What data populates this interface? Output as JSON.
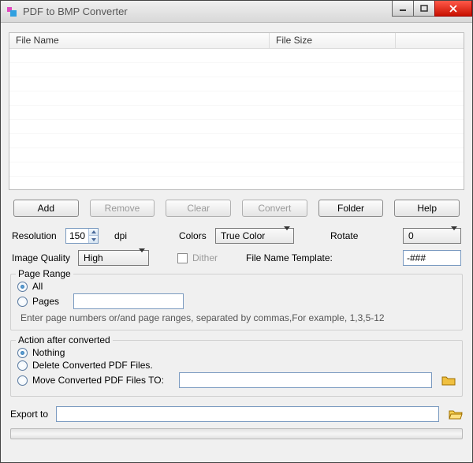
{
  "title": "PDF to BMP Converter",
  "columns": {
    "filename": "File Name",
    "filesize": "File Size"
  },
  "buttons": {
    "add": "Add",
    "remove": "Remove",
    "clear": "Clear",
    "convert": "Convert",
    "folder": "Folder",
    "help": "Help"
  },
  "settings": {
    "resolution_label": "Resolution",
    "resolution_value": "150",
    "dpi_label": "dpi",
    "colors_label": "Colors",
    "colors_value": "True Color",
    "rotate_label": "Rotate",
    "rotate_value": "0",
    "quality_label": "Image Quality",
    "quality_value": "High",
    "dither_label": "Dither",
    "template_label": "File Name Template:",
    "template_value": "-###"
  },
  "pagerange": {
    "legend": "Page Range",
    "all": "All",
    "pages": "Pages",
    "pages_value": "",
    "hint": "Enter page numbers or/and page ranges, separated by commas,For example, 1,3,5-12"
  },
  "action": {
    "legend": "Action after converted",
    "nothing": "Nothing",
    "delete": "Delete Converted PDF Files.",
    "move": "Move Converted PDF Files TO:",
    "move_path": ""
  },
  "export": {
    "label": "Export to",
    "value": ""
  }
}
